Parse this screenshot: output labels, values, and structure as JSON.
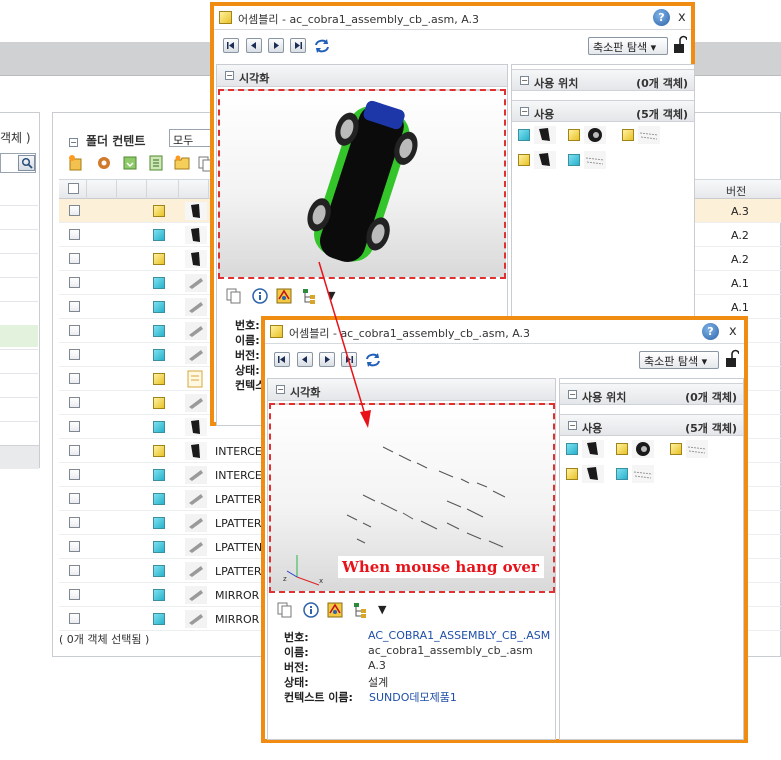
{
  "left_panel": {
    "title": "객체 )"
  },
  "folder_contents": {
    "title": "폴더 컨텐트",
    "filter_value": "모두",
    "version_header": "버전",
    "footer": "( 0개 객체 선택됨 )",
    "rows": [
      {
        "type": "asm",
        "name": "",
        "version": "A.3"
      },
      {
        "type": "part",
        "name": "",
        "version": "A.2"
      },
      {
        "type": "asm",
        "name": "",
        "version": "A.2"
      },
      {
        "type": "part",
        "name": "",
        "version": "A.1"
      },
      {
        "type": "part",
        "name": "",
        "version": "A.1"
      },
      {
        "type": "part",
        "name": "",
        "version": ""
      },
      {
        "type": "part",
        "name": "",
        "version": ""
      },
      {
        "type": "asm",
        "name": "",
        "version": ""
      },
      {
        "type": "asm",
        "name": "",
        "version": ""
      },
      {
        "type": "part",
        "name": "",
        "version": ""
      },
      {
        "type": "asm",
        "name": "INTERCE",
        "version": ""
      },
      {
        "type": "part",
        "name": "INTERCE",
        "version": ""
      },
      {
        "type": "part",
        "name": "LPATTER",
        "version": ""
      },
      {
        "type": "part",
        "name": "LPATTER",
        "version": ""
      },
      {
        "type": "part",
        "name": "LPATTEN",
        "version": ""
      },
      {
        "type": "part",
        "name": "LPATTER",
        "version": ""
      },
      {
        "type": "part",
        "name": "MIRROR",
        "version": ""
      },
      {
        "type": "part",
        "name": "MIRROR",
        "version": ""
      }
    ]
  },
  "popup_back": {
    "title": "어셈블리 - ac_cobra1_assembly_cb_.asm, A.3",
    "help": "?",
    "close": "x",
    "explore_label": "축소판 탐색",
    "visualization_label": "시각화",
    "used_by_label": "사용 위치",
    "used_by_count": "(0개 객체)",
    "uses_label": "사용",
    "uses_count": "(5개 객체)",
    "info_keys": [
      "번호:",
      "이름:",
      "버전:",
      "상태:",
      "컨텍스"
    ]
  },
  "popup_front": {
    "title": "어셈블리 - ac_cobra1_assembly_cb_.asm, A.3",
    "help": "?",
    "close": "x",
    "explore_label": "축소판 탐색",
    "visualization_label": "시각화",
    "used_by_label": "사용 위치",
    "used_by_count": "(0개 객체)",
    "uses_label": "사용",
    "uses_count": "(5개 객체)",
    "info": [
      {
        "key": "번호:",
        "value": "AC_COBRA1_ASSEMBLY_CB_.ASM",
        "link": true
      },
      {
        "key": "이름:",
        "value": "ac_cobra1_assembly_cb_.asm",
        "link": false
      },
      {
        "key": "버전:",
        "value": "A.3",
        "link": false
      },
      {
        "key": "상태:",
        "value": "설계",
        "link": false
      },
      {
        "key": "컨텍스트 이름:",
        "value": "SUNDO데모제품1",
        "link": true
      }
    ]
  },
  "annotation": "When mouse hang over",
  "colors": {
    "window_border": "#f08c12",
    "annotation_red": "#e8131a",
    "selected_row": "#fdf0d8"
  }
}
